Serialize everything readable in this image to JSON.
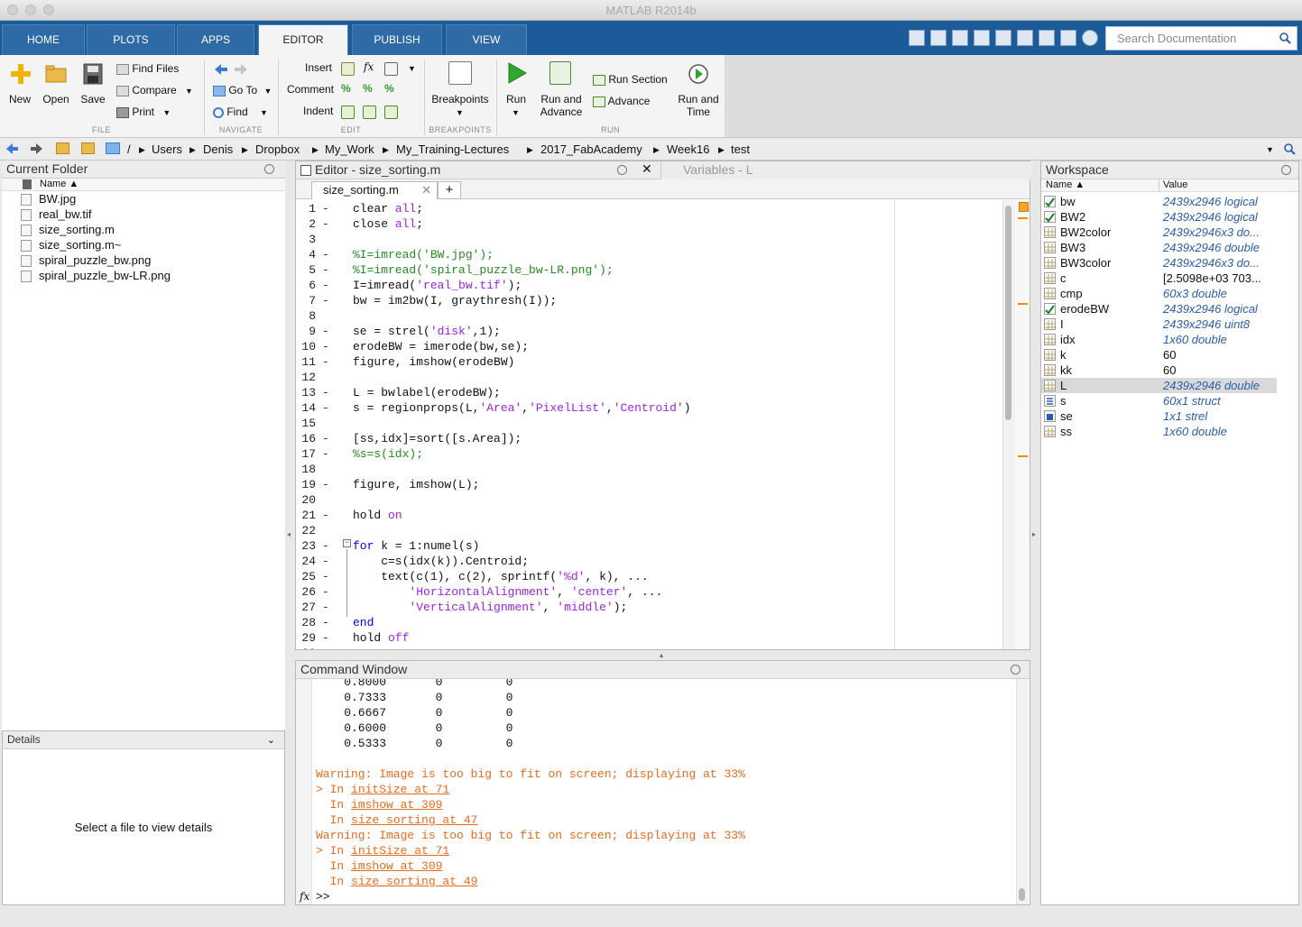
{
  "window": {
    "title": "MATLAB R2014b"
  },
  "tabs": [
    "HOME",
    "PLOTS",
    "APPS",
    "EDITOR",
    "PUBLISH",
    "VIEW"
  ],
  "search": {
    "placeholder": "Search Documentation"
  },
  "ribbon": {
    "file": {
      "new": "New",
      "open": "Open",
      "save": "Save",
      "find_files": "Find Files",
      "compare": "Compare",
      "print": "Print",
      "label": "FILE"
    },
    "navigate": {
      "go_to": "Go To",
      "find": "Find",
      "label": "NAVIGATE"
    },
    "edit": {
      "insert": "Insert",
      "comment": "Comment",
      "indent": "Indent",
      "fx": "fx",
      "label": "EDIT"
    },
    "breakpoints": {
      "button": "Breakpoints",
      "label": "BREAKPOINTS"
    },
    "run": {
      "run": "Run",
      "run_and_advance_1": "Run and",
      "run_and_advance_2": "Advance",
      "run_section": "Run Section",
      "advance": "Advance",
      "run_and_time_1": "Run and",
      "run_and_time_2": "Time",
      "label": "RUN"
    }
  },
  "path": [
    "/",
    "Users",
    "Denis",
    "Dropbox",
    "My_Work",
    "My_Training-Lectures",
    "2017_FabAcademy",
    "Week16",
    "test"
  ],
  "current_folder": {
    "title": "Current Folder",
    "column_name": "Name ▲",
    "files": [
      "BW.jpg",
      "real_bw.tif",
      "size_sorting.m",
      "size_sorting.m~",
      "spiral_puzzle_bw.png",
      "spiral_puzzle_bw-LR.png"
    ]
  },
  "details": {
    "title": "Details",
    "message": "Select a file to view details"
  },
  "editor": {
    "title": "Editor - size_sorting.m",
    "variables_tab": "Variables - L",
    "file_tab": "size_sorting.m",
    "add_tab": "+",
    "lines": [
      {
        "n": "1",
        "html": "clear <span class='str'>all</span>;"
      },
      {
        "n": "2",
        "html": "close <span class='str'>all</span>;"
      },
      {
        "n": "3",
        "html": ""
      },
      {
        "n": "4",
        "html": "<span class='cm'>%I=imread('BW.jpg');</span>"
      },
      {
        "n": "5",
        "html": "<span class='cm'>%I=imread('spiral_puzzle_bw-LR.png');</span>"
      },
      {
        "n": "6",
        "html": "I=imread(<span class='str'>'real_bw.tif'</span>);"
      },
      {
        "n": "7",
        "html": "bw = im2bw(I, graythresh(I));"
      },
      {
        "n": "8",
        "html": ""
      },
      {
        "n": "9",
        "html": "se = strel(<span class='str'>'disk'</span>,1);"
      },
      {
        "n": "10",
        "html": "erodeBW = imerode(bw,se);"
      },
      {
        "n": "11",
        "html": "figure, imshow(erodeBW)"
      },
      {
        "n": "12",
        "html": ""
      },
      {
        "n": "13",
        "html": "L = bwlabel(erodeBW);"
      },
      {
        "n": "14",
        "html": "s = regionprops(L,<span class='str'>'Area'</span>,<span class='str'>'PixelList'</span>,<span class='str'>'Centroid'</span>)"
      },
      {
        "n": "15",
        "html": ""
      },
      {
        "n": "16",
        "html": "[ss,idx]=sort([s.Area]);"
      },
      {
        "n": "17",
        "html": "<span class='cm'>%s=s(idx);</span>"
      },
      {
        "n": "18",
        "html": ""
      },
      {
        "n": "19",
        "html": "figure, imshow(L);"
      },
      {
        "n": "20",
        "html": ""
      },
      {
        "n": "21",
        "html": "hold <span class='str'>on</span>"
      },
      {
        "n": "22",
        "html": ""
      },
      {
        "n": "23",
        "html": "<span class='kw'>for</span> k = 1:numel(s)"
      },
      {
        "n": "24",
        "html": "    c=s(idx(k)).Centroid;"
      },
      {
        "n": "25",
        "html": "    text(c(1), c(2), sprintf(<span class='str'>'%d'</span>, k), <span class='kw'>...</span>"
      },
      {
        "n": "26",
        "html": "        <span class='str'>'HorizontalAlignment'</span>, <span class='str'>'center'</span>, <span class='kw'>...</span>"
      },
      {
        "n": "27",
        "html": "        <span class='str'>'VerticalAlignment'</span>, <span class='str'>'middle'</span>);"
      },
      {
        "n": "28",
        "html": "<span class='kw'>end</span>"
      },
      {
        "n": "29",
        "html": "hold <span class='str'>off</span>"
      }
    ]
  },
  "command_window": {
    "title": "Command Window",
    "matrix_rows": [
      [
        "0.8000",
        "0",
        "0"
      ],
      [
        "0.7333",
        "0",
        "0"
      ],
      [
        "0.6667",
        "0",
        "0"
      ],
      [
        "0.6000",
        "0",
        "0"
      ],
      [
        "0.5333",
        "0",
        "0"
      ]
    ],
    "warning": "Warning: Image is too big to fit on screen; displaying at 33%",
    "trace1": [
      {
        "prefix": "> In ",
        "link": "initSize at 71"
      },
      {
        "prefix": "  In ",
        "link": "imshow at 309"
      },
      {
        "prefix": "  In ",
        "link": "size_sorting at 47"
      }
    ],
    "trace2": [
      {
        "prefix": "> In ",
        "link": "initSize at 71"
      },
      {
        "prefix": "  In ",
        "link": "imshow at 309"
      },
      {
        "prefix": "  In ",
        "link": "size_sorting at 49"
      }
    ],
    "prompt": ">>",
    "fx": "fx"
  },
  "workspace": {
    "title": "Workspace",
    "col_name": "Name ▲",
    "col_value": "Value",
    "vars": [
      {
        "name": "bw",
        "value": "2439x2946 logical",
        "italic": true,
        "icon": "check"
      },
      {
        "name": "BW2",
        "value": "2439x2946 logical",
        "italic": true,
        "icon": "check"
      },
      {
        "name": "BW2color",
        "value": "2439x2946x3 do...",
        "italic": true,
        "icon": "grid"
      },
      {
        "name": "BW3",
        "value": "2439x2946 double",
        "italic": true,
        "icon": "grid"
      },
      {
        "name": "BW3color",
        "value": "2439x2946x3 do...",
        "italic": true,
        "icon": "grid"
      },
      {
        "name": "c",
        "value": "[2.5098e+03 703...",
        "italic": false,
        "icon": "grid"
      },
      {
        "name": "cmp",
        "value": "60x3 double",
        "italic": true,
        "icon": "grid"
      },
      {
        "name": "erodeBW",
        "value": "2439x2946 logical",
        "italic": true,
        "icon": "check"
      },
      {
        "name": "I",
        "value": "2439x2946 uint8",
        "italic": true,
        "icon": "grid"
      },
      {
        "name": "idx",
        "value": "1x60 double",
        "italic": true,
        "icon": "grid"
      },
      {
        "name": "k",
        "value": "60",
        "italic": false,
        "icon": "grid"
      },
      {
        "name": "kk",
        "value": "60",
        "italic": false,
        "icon": "grid"
      },
      {
        "name": "L",
        "value": "2439x2946 double",
        "italic": true,
        "icon": "grid",
        "selected": true
      },
      {
        "name": "s",
        "value": "60x1 struct",
        "italic": true,
        "icon": "struct"
      },
      {
        "name": "se",
        "value": "1x1 strel",
        "italic": true,
        "icon": "object"
      },
      {
        "name": "ss",
        "value": "1x60 double",
        "italic": true,
        "icon": "grid"
      }
    ]
  },
  "colors": {
    "tabbar": "#1b5b9a",
    "keyword": "#0000ff",
    "string": "#a020f0",
    "comment": "#228b22",
    "warning": "#ec6a1b"
  }
}
